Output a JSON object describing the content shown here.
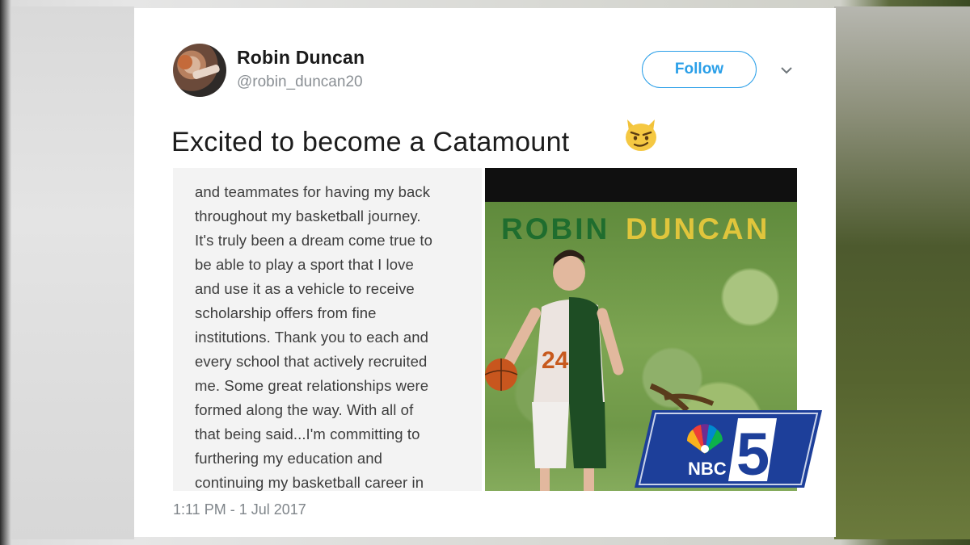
{
  "tweet": {
    "user_name": "Robin Duncan",
    "handle": "@robin_duncan20",
    "follow_label": "Follow",
    "text": "Excited to become a Catamount",
    "emoji": "cat-face-icon",
    "timestamp": "1:11 PM - 1 Jul 2017",
    "letter_lines": [
      "and teammates for having my back",
      "throughout my basketball journey.",
      "It's truly been a dream come true to",
      "be able to play a sport that I love",
      "and use it as a vehicle to receive",
      "scholarship offers from fine",
      "institutions. Thank you to each and",
      "every school that actively recruited",
      "me. Some great relationships were",
      "formed along the way. With all of",
      "that being said...I'm committing to",
      "furthering my education and",
      "continuing my basketball career in"
    ],
    "photo_name_first": "ROBIN",
    "photo_name_last": "DUNCAN",
    "jersey_number": "24"
  },
  "broadcast": {
    "network": "NBC",
    "channel": "5"
  },
  "colors": {
    "accent": "#2a9fe8",
    "nbc_blue": "#1d3f9a"
  }
}
